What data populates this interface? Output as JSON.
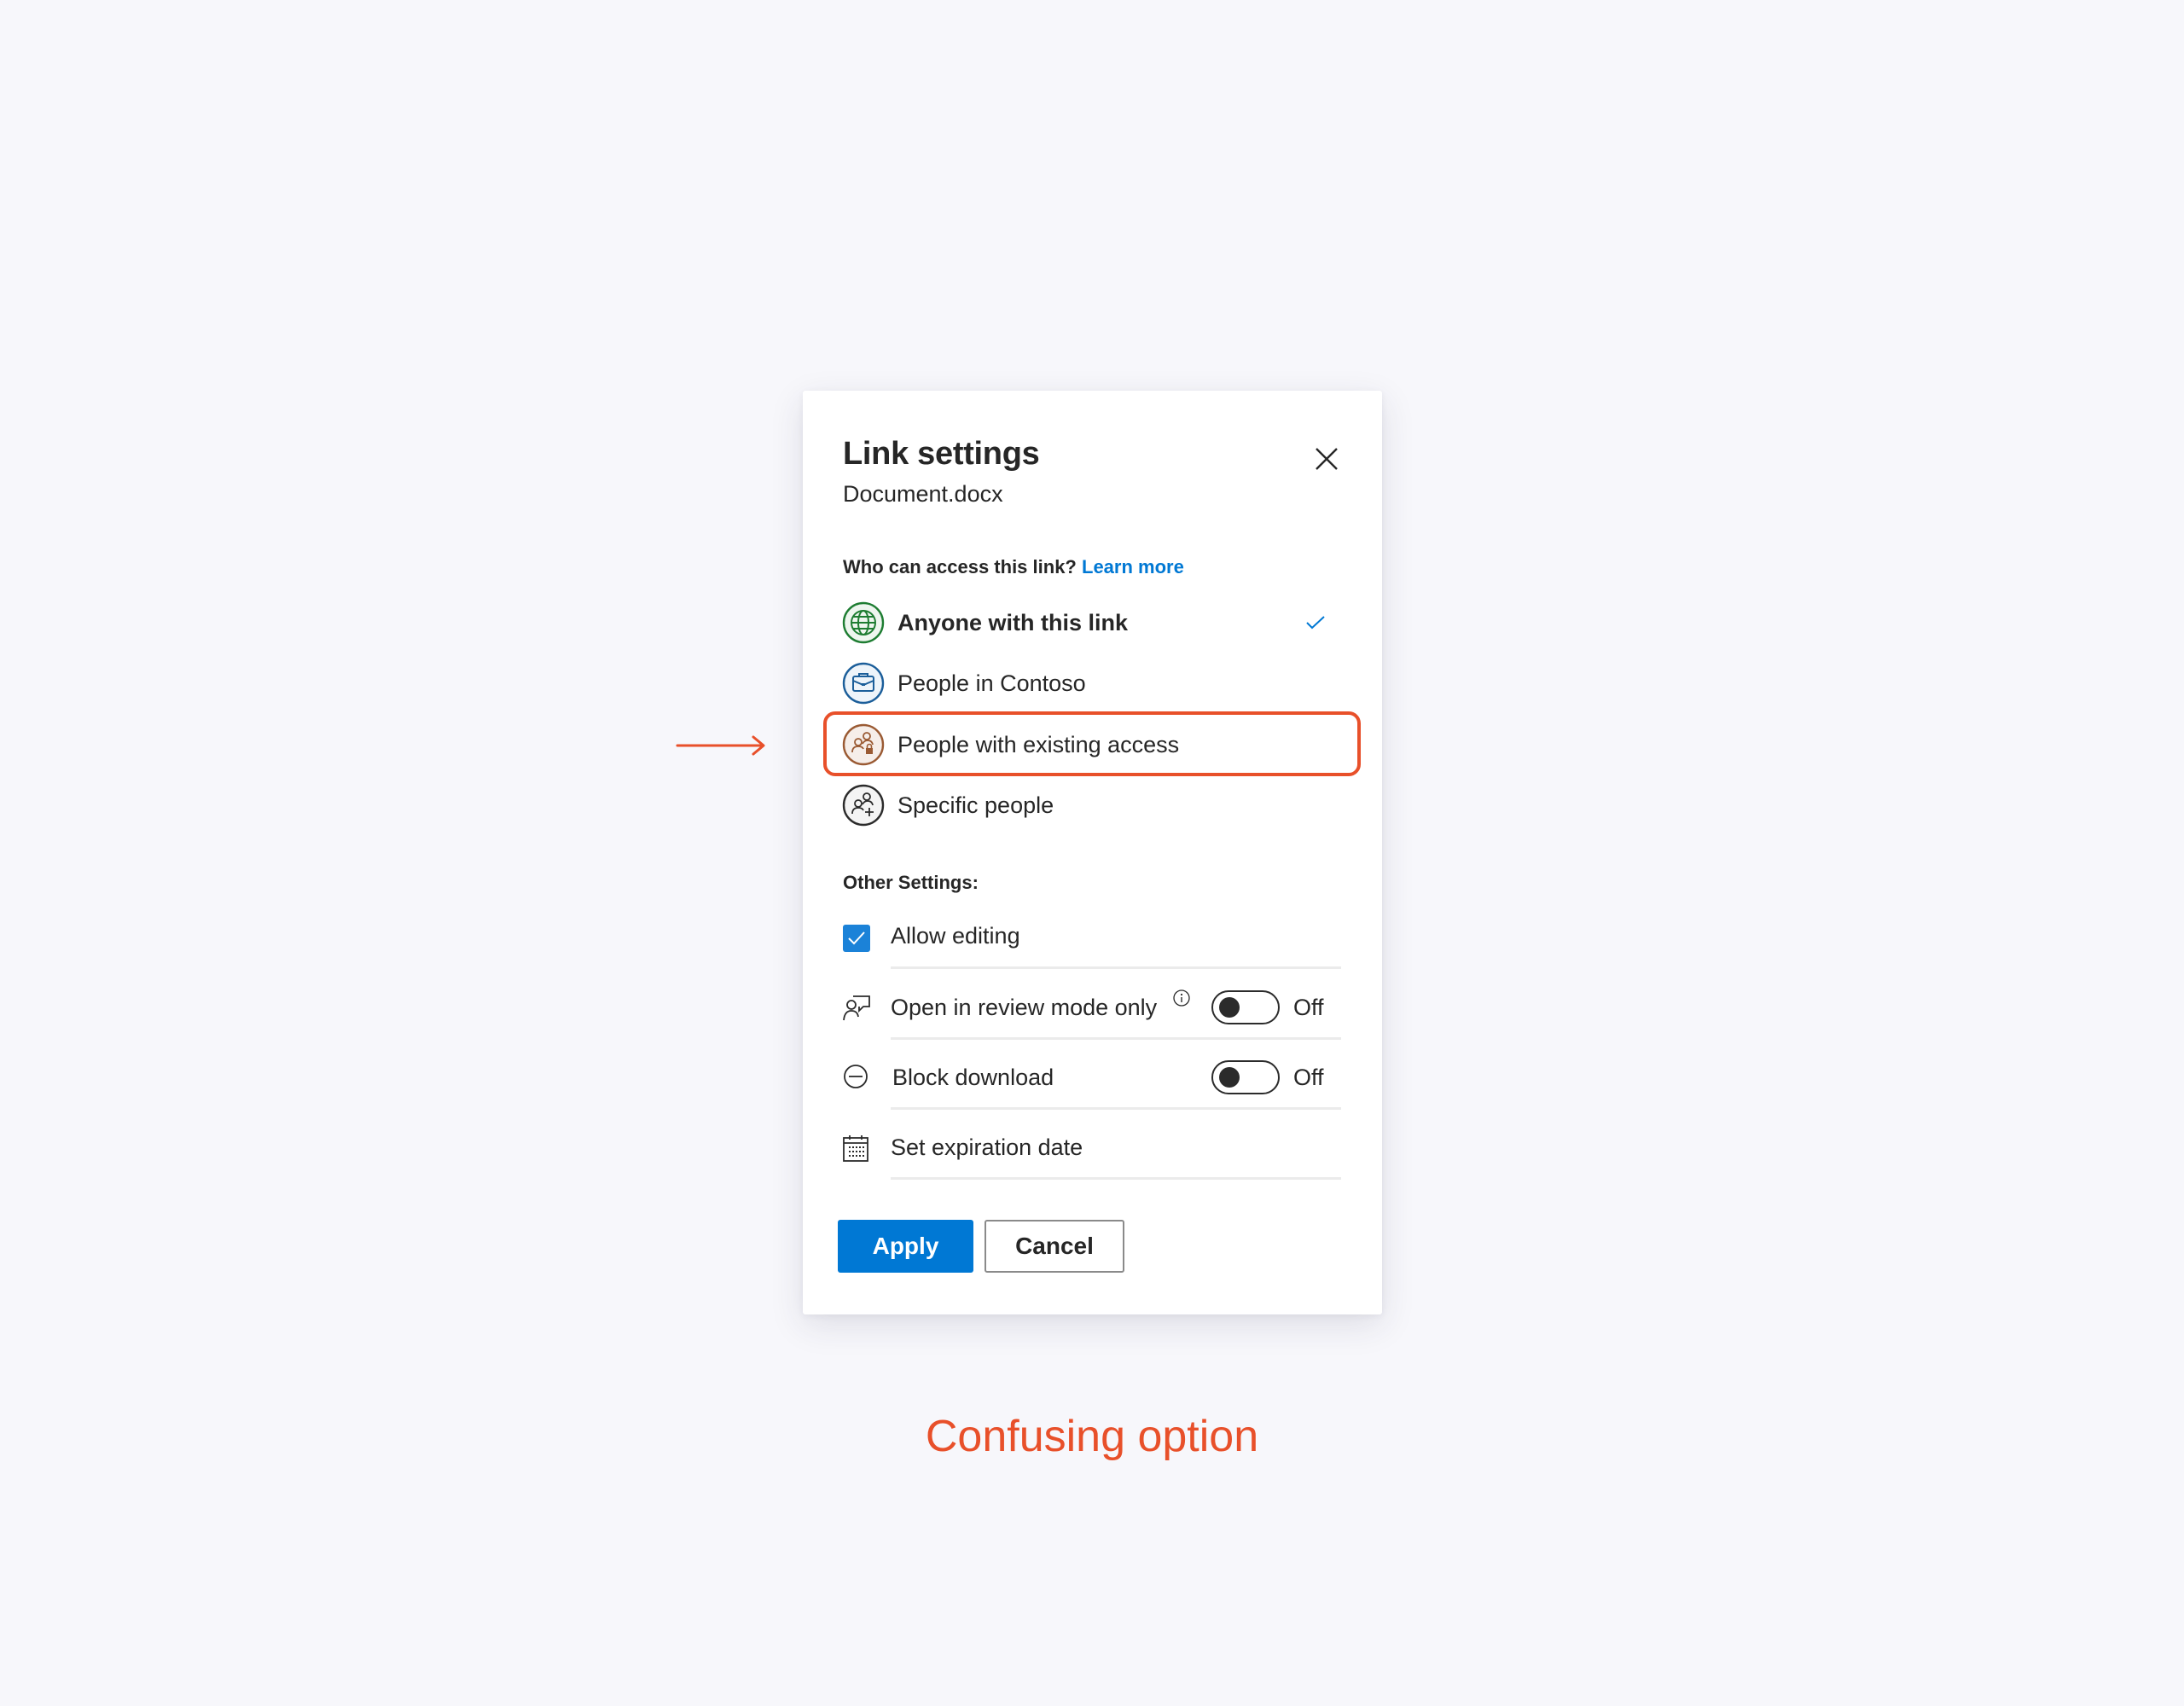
{
  "dialog": {
    "title": "Link settings",
    "subtitle": "Document.docx",
    "close_icon": "close-icon",
    "question": "Who can access this link?",
    "learn_more": "Learn more",
    "access_options": [
      {
        "label": "Anyone with this link",
        "icon": "globe-icon",
        "selected": true,
        "color": "#1E7D32"
      },
      {
        "label": "People in Contoso",
        "icon": "briefcase-icon",
        "selected": false,
        "color": "#1B5E9A"
      },
      {
        "label": "People with existing access",
        "icon": "people-lock-icon",
        "selected": false,
        "color": "#9A5A33"
      },
      {
        "label": "Specific people",
        "icon": "people-add-icon",
        "selected": false,
        "color": "#2B2B2B"
      }
    ],
    "other_settings_label": "Other Settings:",
    "settings": [
      {
        "label": "Allow editing",
        "control": "checkbox",
        "checked": true
      },
      {
        "label": "Open in review mode only",
        "icon": "review-person-icon",
        "control": "toggle",
        "state": "Off",
        "info_icon": "info-icon"
      },
      {
        "label": "Block download",
        "icon": "block-icon",
        "control": "toggle",
        "state": "Off"
      },
      {
        "label": "Set expiration date",
        "icon": "calendar-icon",
        "control": "none"
      }
    ],
    "apply_label": "Apply",
    "cancel_label": "Cancel"
  },
  "annotation": {
    "caption": "Confusing option",
    "highlighted_option": "People with existing access",
    "color": "#E8502A"
  },
  "colors": {
    "accent": "#0078D4",
    "background": "#F7F7FB"
  }
}
